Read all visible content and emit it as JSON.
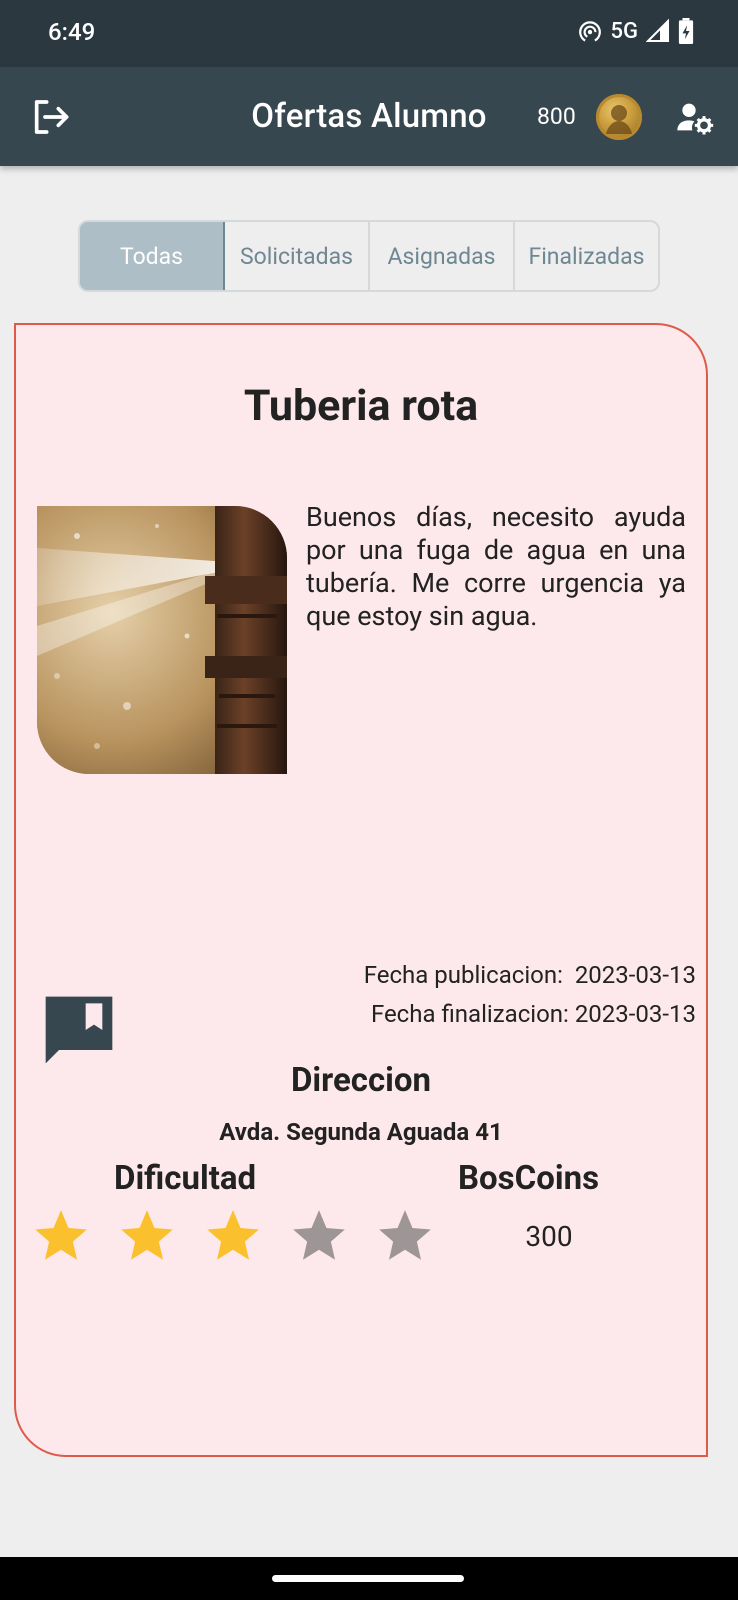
{
  "status_bar": {
    "time": "6:49",
    "network": "5G"
  },
  "header": {
    "title": "Ofertas Alumno",
    "coins": "800",
    "coin_avatar": "coin-portrait",
    "icons": [
      "logout-icon",
      "manage-accounts-icon"
    ]
  },
  "tabs": [
    {
      "label": "Todas",
      "active": true
    },
    {
      "label": "Solicitadas",
      "active": false
    },
    {
      "label": "Asignadas",
      "active": false
    },
    {
      "label": "Finalizadas",
      "active": false
    }
  ],
  "offer": {
    "title": "Tuberia rota",
    "image": "broken-pipe-photo",
    "description": "Buenos días, necesito ayuda por una fuga de agua en una tubería. Me corre urgencia ya que estoy sin agua.",
    "publication_label": "Fecha publicacion:  2023-03-13",
    "end_label": "Fecha finalizacion: 2023-03-13",
    "address_title": "Direccion",
    "address": "Avda. Segunda Aguada 41",
    "difficulty_title": "Dificultad",
    "difficulty_rating": 3,
    "difficulty_max": 5,
    "coins_title": "BosCoins",
    "coins_value": "300"
  },
  "colors": {
    "app_bar": "#37474f",
    "card_bg": "#fde9ec",
    "card_border": "#e05a4a",
    "star_on": "#fbc02d",
    "star_off": "#9e9696",
    "tab_active": "#adbec6"
  }
}
